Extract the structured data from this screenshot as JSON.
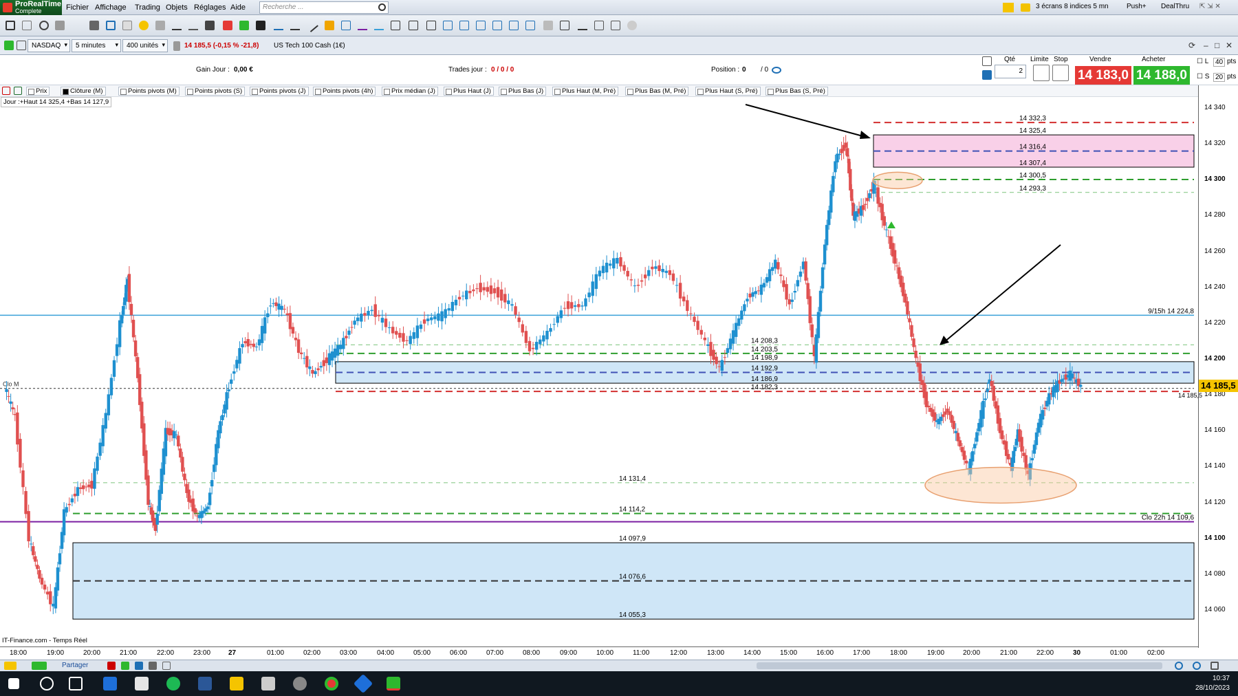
{
  "app": {
    "name": "ProRealTime",
    "edition": "Complete"
  },
  "menu": [
    "Fichier",
    "Affichage",
    "Trading",
    "Objets",
    "Réglages",
    "Aide"
  ],
  "search": {
    "placeholder": "Recherche ..."
  },
  "top_right": {
    "layout": "3 écrans 8 indices 5 mn",
    "push": "Push+",
    "dealthru": "DealThru"
  },
  "chart_bar": {
    "market": "NASDAQ",
    "timeframe": "5 minutes",
    "units": "400 unités",
    "quote": "14 185,5 (-0,15 % -21,8)",
    "instrument": "US Tech 100 Cash (1€)"
  },
  "info": {
    "gain_label": "Gain Jour :",
    "gain_value": "0,00 €",
    "trades_label": "Trades jour :",
    "trades_value": "0 / 0 / 0",
    "position_label": "Position :",
    "position_value": "0",
    "position_extra": "/ 0"
  },
  "order_panel": {
    "qty_label": "Qté",
    "qty_value": "2",
    "limit_label": "Limite",
    "stop_label": "Stop",
    "sell_label": "Vendre",
    "buy_label": "Acheter",
    "sell_price": "14 183,0",
    "buy_price": "14 188,0",
    "l_label": "L",
    "s_label": "S",
    "l_pts": "40",
    "s_pts": "20",
    "pts": "pts"
  },
  "indicators": [
    {
      "label": "Prix",
      "on": false
    },
    {
      "label": "Clôture (M)",
      "on": true
    },
    {
      "label": "Points pivots (M)",
      "on": false
    },
    {
      "label": "Points pivots (S)",
      "on": false
    },
    {
      "label": "Points pivots (J)",
      "on": false
    },
    {
      "label": "Points pivots (4h)",
      "on": false
    },
    {
      "label": "Prix médian (J)",
      "on": false
    },
    {
      "label": "Plus Haut (J)",
      "on": false
    },
    {
      "label": "Plus Bas (J)",
      "on": false
    },
    {
      "label": "Plus Haut (M, Pré)",
      "on": false
    },
    {
      "label": "Plus Bas (M, Pré)",
      "on": false
    },
    {
      "label": "Plus Haut (S, Pré)",
      "on": false
    },
    {
      "label": "Plus Bas (S, Pré)",
      "on": false
    }
  ],
  "jour_label": "Jour :+Haut 14 325,4 +Bas 14 127,9",
  "chart_data": {
    "type": "candlestick",
    "interval": "5 minutes",
    "ylim": [
      14050,
      14350
    ],
    "y_ticks": [
      "14 340",
      "14 320",
      "14 300",
      "14 280",
      "14 260",
      "14 240",
      "14 220",
      "14 200",
      "14 180",
      "14 160",
      "14 140",
      "14 120",
      "14 100",
      "14 080",
      "14 060"
    ],
    "y_ticks_bold": [
      "14 300",
      "14 200",
      "14 100"
    ],
    "x_ticks": [
      "18:00",
      "19:00",
      "20:00",
      "21:00",
      "22:00",
      "23:00",
      "27",
      "01:00",
      "02:00",
      "03:00",
      "04:00",
      "05:00",
      "06:00",
      "07:00",
      "08:00",
      "09:00",
      "10:00",
      "11:00",
      "12:00",
      "13:00",
      "14:00",
      "15:00",
      "16:00",
      "17:00",
      "18:00",
      "19:00",
      "20:00",
      "21:00",
      "22:00",
      "30",
      "01:00",
      "02:00"
    ],
    "last_price": "14 185,5",
    "last_price_small": "14 185,5",
    "levels": [
      {
        "value": 14332.3,
        "label": "14 332,3",
        "color": "#d32f2f",
        "style": "dashed"
      },
      {
        "value": 14325.4,
        "label": "14 325,4",
        "color": "#000000",
        "style": "box-top"
      },
      {
        "value": 14316.4,
        "label": "14 316,4",
        "color": "#3f51b5",
        "style": "dashed"
      },
      {
        "value": 14307.4,
        "label": "14 307,4",
        "color": "#000000",
        "style": "box-bottom"
      },
      {
        "value": 14300.5,
        "label": "14 300,5",
        "color": "#2e9e2e",
        "style": "dashed"
      },
      {
        "value": 14293.3,
        "label": "14 293,3",
        "color": "#7cc47c",
        "style": "dashed-light"
      },
      {
        "value": 14208.3,
        "label": "14 208,3",
        "color": "#7cc47c",
        "style": "dashed-light"
      },
      {
        "value": 14203.5,
        "label": "14 203,5",
        "color": "#2e9e2e",
        "style": "dashed"
      },
      {
        "value": 14198.9,
        "label": "14 198,9",
        "color": "#000000",
        "style": "box-top"
      },
      {
        "value": 14192.9,
        "label": "14 192,9",
        "color": "#3f51b5",
        "style": "dashed"
      },
      {
        "value": 14186.9,
        "label": "14 186,9",
        "color": "#000000",
        "style": "box-bottom"
      },
      {
        "value": 14182.3,
        "label": "14 182,3",
        "color": "#d32f2f",
        "style": "dashed"
      },
      {
        "value": 14131.4,
        "label": "14 131,4",
        "color": "#7cc47c",
        "style": "dashed-light"
      },
      {
        "value": 14114.2,
        "label": "14 114,2",
        "color": "#2e9e2e",
        "style": "dashed"
      },
      {
        "value": 14097.9,
        "label": "14 097,9",
        "color": "#000000",
        "style": "box-top"
      },
      {
        "value": 14076.6,
        "label": "14 076,6",
        "color": "#333333",
        "style": "dashed"
      },
      {
        "value": 14055.3,
        "label": "14 055,3",
        "color": "#000000",
        "style": "box-bottom"
      }
    ],
    "annotations": [
      {
        "label": "9/15h 14 224,8",
        "value": 14224.8,
        "color": "#39a0d8"
      },
      {
        "label": "Clo 22h 14 109,6",
        "value": 14109.6,
        "color": "#7b1fa2"
      },
      {
        "label": "Clo M",
        "value": 14184,
        "color": "#333333"
      }
    ],
    "zones": [
      {
        "from": 14307.4,
        "to": 14325.4,
        "color": "#f9d0e8"
      },
      {
        "from": 14186.9,
        "to": 14198.9,
        "color": "#cfe6f7"
      },
      {
        "from": 14055.3,
        "to": 14097.9,
        "color": "#cfe6f7"
      }
    ],
    "series": [
      {
        "t": 0,
        "c": 14185
      },
      {
        "t": 0.3,
        "c": 14168
      },
      {
        "t": 0.7,
        "c": 14100
      },
      {
        "t": 1.0,
        "c": 14078
      },
      {
        "t": 1.4,
        "c": 14062
      },
      {
        "t": 1.7,
        "c": 14115
      },
      {
        "t": 2.1,
        "c": 14128
      },
      {
        "t": 2.5,
        "c": 14130
      },
      {
        "t": 2.9,
        "c": 14170
      },
      {
        "t": 3.3,
        "c": 14220
      },
      {
        "t": 3.5,
        "c": 14245
      },
      {
        "t": 3.8,
        "c": 14190
      },
      {
        "t": 4.1,
        "c": 14120
      },
      {
        "t": 4.3,
        "c": 14105
      },
      {
        "t": 4.6,
        "c": 14160
      },
      {
        "t": 4.9,
        "c": 14158
      },
      {
        "t": 5.2,
        "c": 14125
      },
      {
        "t": 5.5,
        "c": 14112
      },
      {
        "t": 5.8,
        "c": 14118
      },
      {
        "t": 6.1,
        "c": 14160
      },
      {
        "t": 6.4,
        "c": 14185
      },
      {
        "t": 6.8,
        "c": 14210
      },
      {
        "t": 7.2,
        "c": 14207
      },
      {
        "t": 7.6,
        "c": 14232
      },
      {
        "t": 8.0,
        "c": 14228
      },
      {
        "t": 8.4,
        "c": 14205
      },
      {
        "t": 8.8,
        "c": 14192
      },
      {
        "t": 9.2,
        "c": 14200
      },
      {
        "t": 9.6,
        "c": 14208
      },
      {
        "t": 10.0,
        "c": 14222
      },
      {
        "t": 10.5,
        "c": 14228
      },
      {
        "t": 11.0,
        "c": 14217
      },
      {
        "t": 11.5,
        "c": 14210
      },
      {
        "t": 12.0,
        "c": 14222
      },
      {
        "t": 12.5,
        "c": 14225
      },
      {
        "t": 13.0,
        "c": 14235
      },
      {
        "t": 13.5,
        "c": 14240
      },
      {
        "t": 14.0,
        "c": 14238
      },
      {
        "t": 14.5,
        "c": 14230
      },
      {
        "t": 15.0,
        "c": 14205
      },
      {
        "t": 15.5,
        "c": 14215
      },
      {
        "t": 16.0,
        "c": 14230
      },
      {
        "t": 16.5,
        "c": 14230
      },
      {
        "t": 17.0,
        "c": 14250
      },
      {
        "t": 17.5,
        "c": 14256
      },
      {
        "t": 18.0,
        "c": 14240
      },
      {
        "t": 18.5,
        "c": 14252
      },
      {
        "t": 19.0,
        "c": 14248
      },
      {
        "t": 19.5,
        "c": 14228
      },
      {
        "t": 20.0,
        "c": 14210
      },
      {
        "t": 20.4,
        "c": 14195
      },
      {
        "t": 20.8,
        "c": 14215
      },
      {
        "t": 21.2,
        "c": 14235
      },
      {
        "t": 21.6,
        "c": 14240
      },
      {
        "t": 22.0,
        "c": 14255
      },
      {
        "t": 22.4,
        "c": 14230
      },
      {
        "t": 22.8,
        "c": 14255
      },
      {
        "t": 23.1,
        "c": 14200
      },
      {
        "t": 23.4,
        "c": 14265
      },
      {
        "t": 23.7,
        "c": 14312
      },
      {
        "t": 24.0,
        "c": 14320
      },
      {
        "t": 24.2,
        "c": 14280
      },
      {
        "t": 24.5,
        "c": 14285
      },
      {
        "t": 24.8,
        "c": 14298
      },
      {
        "t": 25.1,
        "c": 14275
      },
      {
        "t": 25.4,
        "c": 14255
      },
      {
        "t": 25.7,
        "c": 14232
      },
      {
        "t": 26.0,
        "c": 14200
      },
      {
        "t": 26.3,
        "c": 14175
      },
      {
        "t": 26.6,
        "c": 14165
      },
      {
        "t": 26.9,
        "c": 14172
      },
      {
        "t": 27.2,
        "c": 14155
      },
      {
        "t": 27.5,
        "c": 14138
      },
      {
        "t": 27.8,
        "c": 14165
      },
      {
        "t": 28.1,
        "c": 14190
      },
      {
        "t": 28.4,
        "c": 14160
      },
      {
        "t": 28.7,
        "c": 14140
      },
      {
        "t": 28.9,
        "c": 14160
      },
      {
        "t": 29.2,
        "c": 14135
      },
      {
        "t": 29.5,
        "c": 14165
      },
      {
        "t": 29.8,
        "c": 14180
      },
      {
        "t": 30.1,
        "c": 14188
      },
      {
        "t": 30.4,
        "c": 14192
      },
      {
        "t": 30.7,
        "c": 14185
      }
    ]
  },
  "source": "IT-Finance.com - Temps Réel",
  "bottom": {
    "share_label": "Partager"
  },
  "clock": {
    "time": "10:37",
    "date": "28/10/2023"
  },
  "colors": {
    "up": "#1e90d0",
    "down": "#e05050",
    "accent": "#1b6b2a",
    "sell": "#e53935",
    "buy": "#2eb82e",
    "price_tag": "#f5c400"
  }
}
